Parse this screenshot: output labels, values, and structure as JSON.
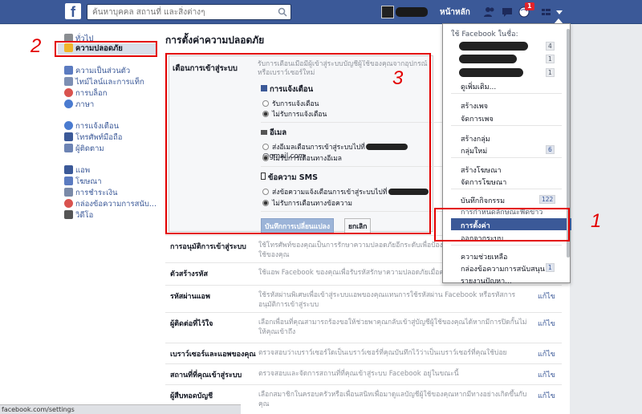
{
  "topbar": {
    "logo": "f",
    "search_placeholder": "ค้นหาบุคคล สถานที่ และสิ่งต่างๆ",
    "home_label": "หน้าหลัก",
    "notif_count": "1"
  },
  "left_nav": {
    "items": [
      {
        "label": "ทั่วไป",
        "icon": "gear-icon"
      },
      {
        "label": "ความปลอดภัย",
        "icon": "shield-icon"
      },
      {
        "label": "ความเป็นส่วนตัว",
        "icon": "lock-icon"
      },
      {
        "label": "ไทม์ไลน์และการแท็ก",
        "icon": "timeline-icon"
      },
      {
        "label": "การบล็อก",
        "icon": "block-icon"
      },
      {
        "label": "ภาษา",
        "icon": "globe-icon"
      },
      {
        "label": "การแจ้งเตือน",
        "icon": "globe-icon"
      },
      {
        "label": "โทรศัพท์มือถือ",
        "icon": "phone-icon"
      },
      {
        "label": "ผู้ติดตาม",
        "icon": "rss-icon"
      },
      {
        "label": "แอพ",
        "icon": "apps-icon"
      },
      {
        "label": "โฆษณา",
        "icon": "ads-icon"
      },
      {
        "label": "การชำระเงิน",
        "icon": "card-icon"
      },
      {
        "label": "กล่องข้อความการสนับ...",
        "icon": "lifering-icon"
      },
      {
        "label": "วิดีโอ",
        "icon": "video-icon"
      }
    ]
  },
  "main": {
    "title": "การตั้งค่าความปลอดภัย",
    "login_alerts": {
      "label": "เตือนการเข้าสู่ระบบ",
      "desc": "รับการเตือนเมื่อมีผู้เข้าสู่ระบบบัญชีผู้ใช้ของคุณจากอุปกรณ์หรือเบราว์เซอร์ใหม่",
      "notif_head": "การแจ้งเตือน",
      "notif_on": "รับการแจ้งเตือน",
      "notif_off": "ไม่รับการแจ้งเตือน",
      "email_head": "อีเมล",
      "email_on_prefix": "ส่งอีเมลเตือนการเข้าสู่ระบบไปที่",
      "email_on_suffix": "@gmail.com",
      "email_off": "ไม่รับการเตือนทางอีเมล",
      "sms_head": "ข้อความ SMS",
      "sms_on": "ส่งข้อความแจ้งเตือนการเข้าสู่ระบบไปที่",
      "sms_off": "ไม่รับการเตือนทางข้อความ",
      "save_label": "บันทึกการเปลี่ยนแปลง",
      "cancel_label": "ยกเลิก"
    },
    "rows": [
      {
        "label": "การอนุมัติการเข้าสู่ระบบ",
        "desc": "ใช้โทรศัพท์ของคุณเป็นการรักษาความปลอดภัยอีกระดับเพื่อป้องกันไม่ให้ผู้อื่นเข้าสู่ระบบบัญชีผู้ใช้ของคุณ",
        "edit": ""
      },
      {
        "label": "ตัวสร้างรหัส",
        "desc": "ใช้แอพ Facebook ของคุณเพื่อรับรหัสรักษาความปลอดภัยเมื่อคุณต้องการ",
        "edit": ""
      },
      {
        "label": "รหัสผ่านแอพ",
        "desc": "ใช้รหัสผ่านพิเศษเพื่อเข้าสู่ระบบแอพของคุณแทนการใช้รหัสผ่าน Facebook หรือรหัสการอนุมัติการเข้าสู่ระบบ",
        "edit": "แก้ไข"
      },
      {
        "label": "ผู้ติดต่อที่ไว้ใจ",
        "desc": "เลือกเพื่อนที่คุณสามารถร้องขอให้ช่วยพาคุณกลับเข้าสู่บัญชีผู้ใช้ของคุณได้หากมีการปิดกั้นไม่ให้คุณเข้าถึง",
        "edit": "แก้ไข"
      },
      {
        "label": "เบราว์เซอร์และแอพของคุณ",
        "desc": "ตรวจสอบว่าเบราว์เซอร์ใดเป็นเบราว์เซอร์ที่คุณบันทึกไว้ว่าเป็นเบราว์เซอร์ที่คุณใช้บ่อย",
        "edit": "แก้ไข"
      },
      {
        "label": "สถานที่ที่คุณเข้าสู่ระบบ",
        "desc": "ตรวจสอบและจัดการสถานที่ที่คุณเข้าสู่ระบบ Facebook อยู่ในขณะนี้",
        "edit": "แก้ไข"
      },
      {
        "label": "ผู้สืบทอดบัญชี",
        "desc": "เลือกสมาชิกในครอบครัวหรือเพื่อนสนิทเพื่อมาดูแลบัญชีผู้ใช้ของคุณหากมีทางอย่างเกิดขึ้นกับคุณ",
        "edit": "แก้ไข"
      }
    ]
  },
  "dropdown": {
    "use_as": "ใช้ Facebook ในชื่อ:",
    "pages_counts": [
      "4",
      "1",
      "1"
    ],
    "see_more": "ดูเพิ่มเติม...",
    "create_page": "สร้างเพจ",
    "manage_pages": "จัดการเพจ",
    "create_group": "สร้างกลุ่ม",
    "new_groups": "กลุ่มใหม่",
    "new_groups_count": "6",
    "create_ads": "สร้างโฆษณา",
    "manage_ads": "จัดการโฆษณา",
    "activity_log": "บันทึกกิจกรรม",
    "activity_count": "122",
    "news_feed_prefs": "การกำหนดลักษณะฟีดข่าว",
    "settings": "การตั้งค่า",
    "logout": "ออกจากระบบ",
    "help": "ความช่วยเหลือ",
    "support_inbox": "กล่องข้อความการสนับสนุน",
    "support_count": "1",
    "report_problem": "รายงานปัญหา..."
  },
  "annotations": [
    "1",
    "2",
    "3"
  ],
  "status_url": "facebook.com/settings",
  "colors": {
    "brand": "#3b5998",
    "annotation": "#e30000"
  }
}
